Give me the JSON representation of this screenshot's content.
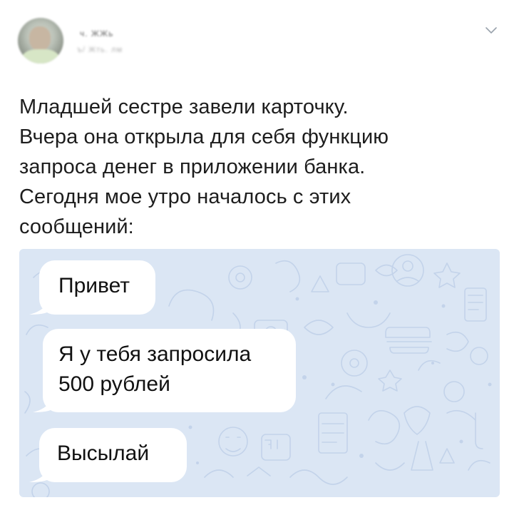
{
  "tweet": {
    "author": {
      "name": "ч. ЖЖь",
      "handle": "ъ/ Жть. лм"
    },
    "menu_icon": "chevron-down-icon",
    "text_lines": [
      "Младшей сестре завели карточку.",
      "Вчера она открыла для себя функцию",
      "запроса денег в приложении банка.",
      "Сегодня мое утро началось с этих",
      "сообщений:"
    ],
    "image": {
      "background_color": "#dbe6f4",
      "messages": [
        {
          "lines": [
            "Привет"
          ]
        },
        {
          "lines": [
            "Я у тебя запросила",
            "500 рублей"
          ]
        },
        {
          "lines": [
            "Высылай"
          ]
        }
      ]
    }
  }
}
